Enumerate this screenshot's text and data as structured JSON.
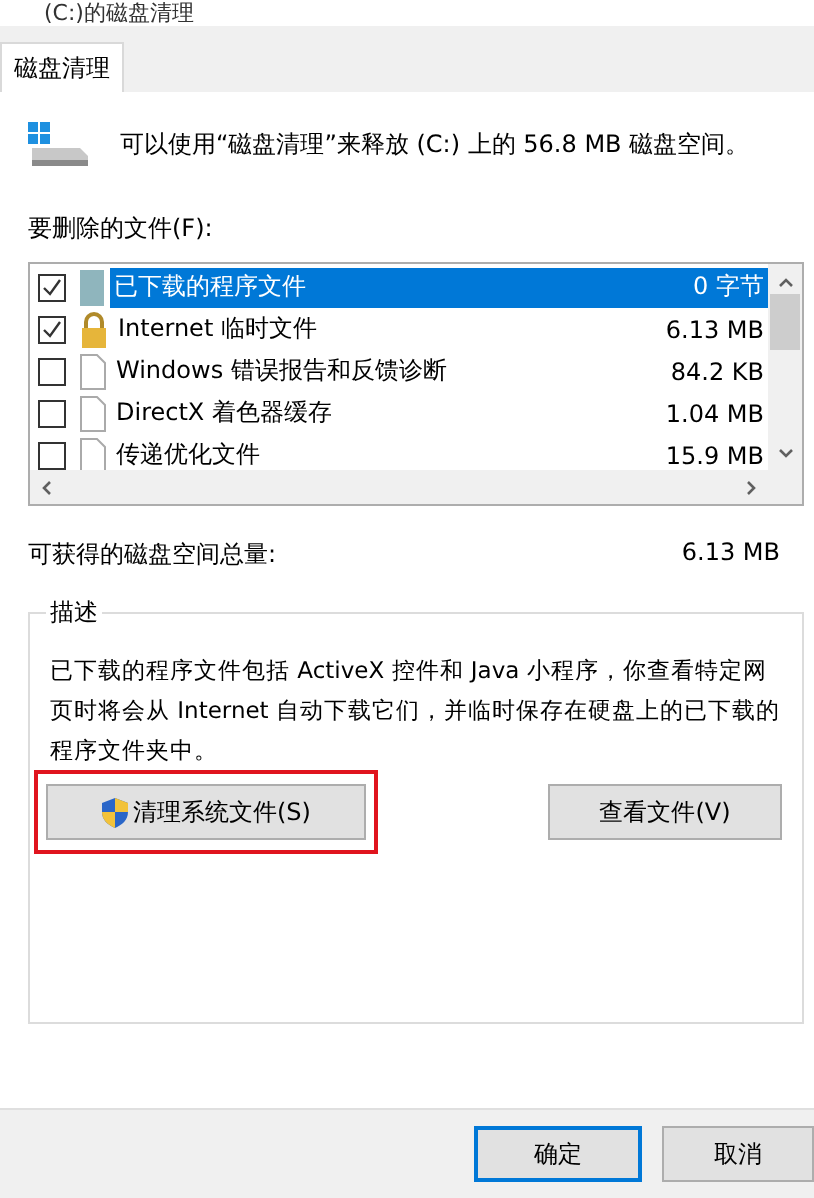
{
  "window": {
    "title": "(C:)的磁盘清理"
  },
  "tabs": [
    {
      "label": "磁盘清理",
      "selected": true
    }
  ],
  "summary": "可以使用“磁盘清理”来释放  (C:) 上的 56.8 MB 磁盘空间。",
  "files_label": "要删除的文件(F):",
  "files": [
    {
      "name": "已下载的程序文件",
      "size": "0 字节",
      "checked": true,
      "selected": true,
      "kind": "folder"
    },
    {
      "name": "Internet 临时文件",
      "size": "6.13 MB",
      "checked": true,
      "selected": false,
      "kind": "lock"
    },
    {
      "name": "Windows 错误报告和反馈诊断",
      "size": "84.2 KB",
      "checked": false,
      "selected": false,
      "kind": "file"
    },
    {
      "name": "DirectX 着色器缓存",
      "size": "1.04 MB",
      "checked": false,
      "selected": false,
      "kind": "file"
    },
    {
      "name": "传递优化文件",
      "size": "15.9 MB",
      "checked": false,
      "selected": false,
      "kind": "file"
    }
  ],
  "total": {
    "label": "可获得的磁盘空间总量:",
    "value": "6.13 MB"
  },
  "description": {
    "legend": "描述",
    "text": "已下载的程序文件包括 ActiveX 控件和 Java 小程序，你查看特定网页时将会从 Internet 自动下载它们，并临时保存在硬盘上的已下载的程序文件夹中。"
  },
  "clean_system_button": {
    "label": "清理系统文件(S)",
    "highlighted": true
  },
  "view_files_button": "查看文件(V)",
  "buttons": [
    {
      "label": "确定",
      "default": true
    },
    {
      "label": "取消",
      "default": false
    }
  ]
}
